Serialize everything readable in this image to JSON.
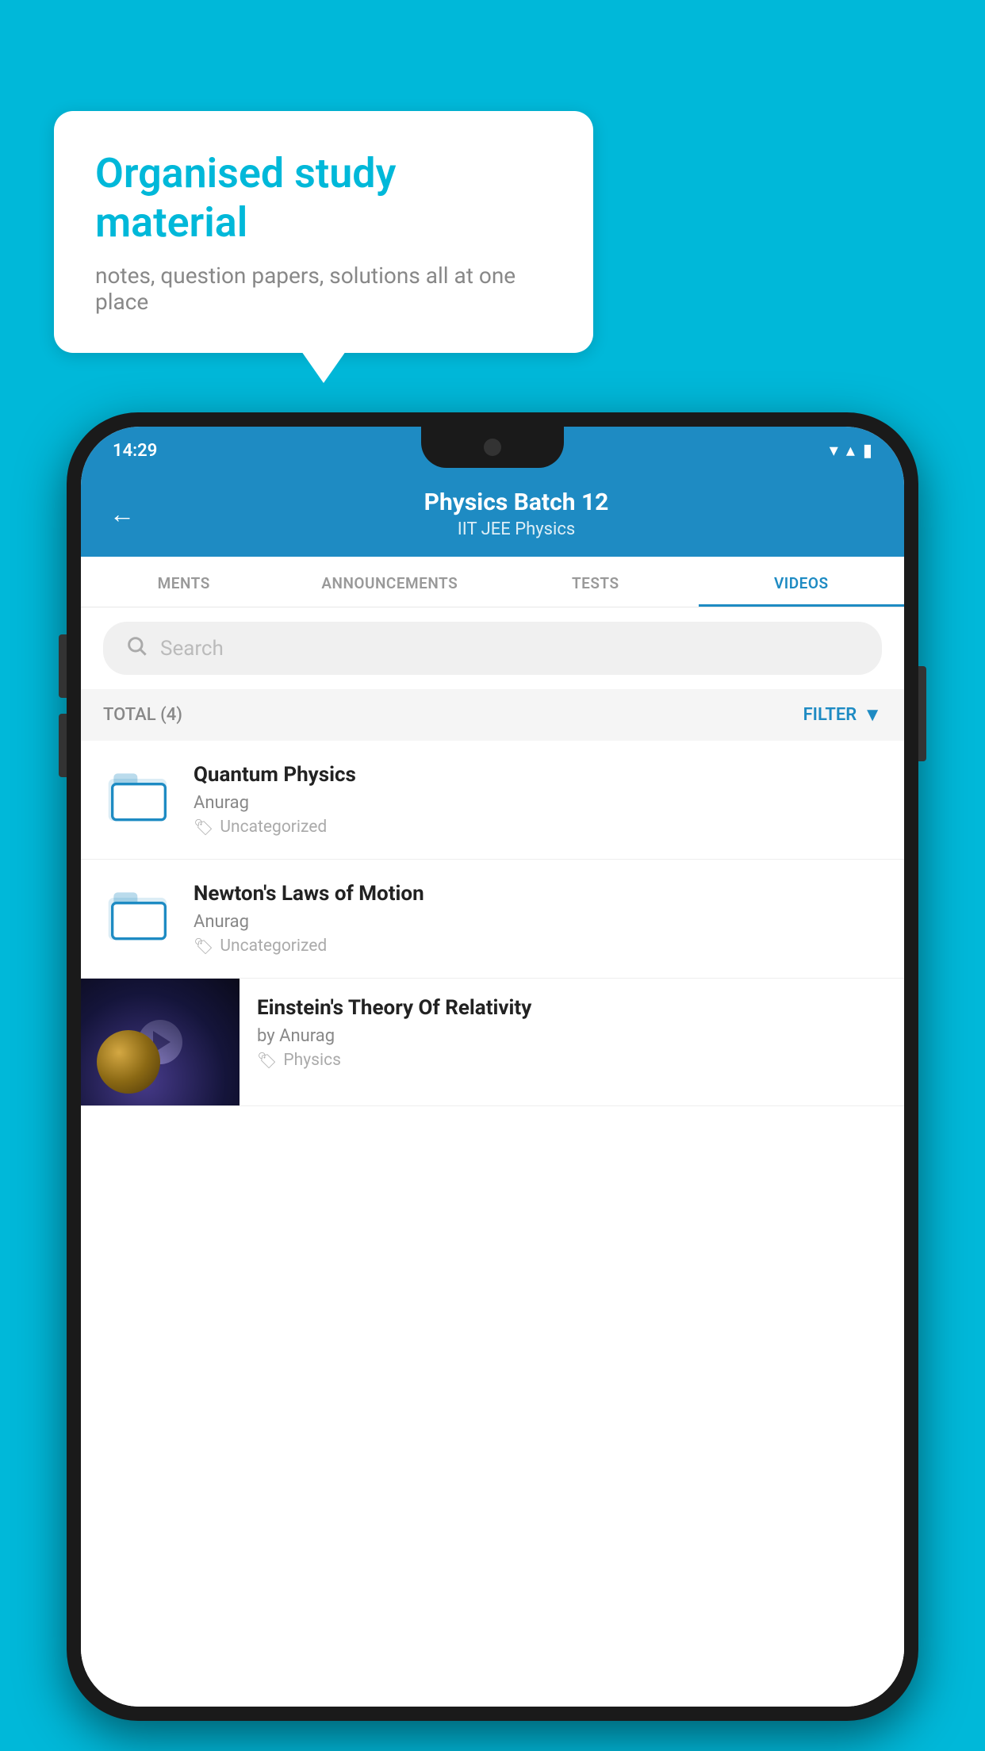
{
  "background": {
    "color": "#00B8D9"
  },
  "speech_bubble": {
    "title": "Organised study material",
    "subtitle": "notes, question papers, solutions all at one place"
  },
  "phone": {
    "status_bar": {
      "time": "14:29",
      "wifi": "▾",
      "signal": "▴",
      "battery": "▮"
    },
    "header": {
      "back_label": "←",
      "title": "Physics Batch 12",
      "subtitle": "IIT JEE   Physics"
    },
    "tabs": [
      {
        "label": "MENTS",
        "active": false
      },
      {
        "label": "ANNOUNCEMENTS",
        "active": false
      },
      {
        "label": "TESTS",
        "active": false
      },
      {
        "label": "VIDEOS",
        "active": true
      }
    ],
    "search": {
      "placeholder": "Search"
    },
    "filter_row": {
      "total_label": "TOTAL (4)",
      "filter_label": "FILTER"
    },
    "videos": [
      {
        "title": "Quantum Physics",
        "author": "Anurag",
        "tag": "Uncategorized",
        "type": "folder"
      },
      {
        "title": "Newton's Laws of Motion",
        "author": "Anurag",
        "tag": "Uncategorized",
        "type": "folder"
      },
      {
        "title": "Einstein's Theory Of Relativity",
        "author": "by Anurag",
        "tag": "Physics",
        "type": "video"
      }
    ]
  }
}
